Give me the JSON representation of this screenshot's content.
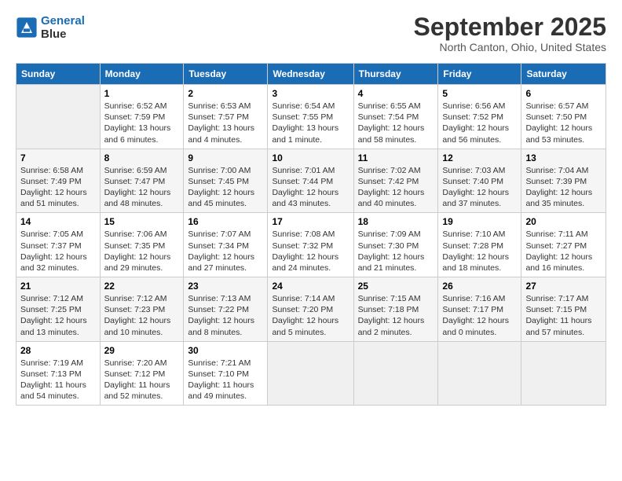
{
  "header": {
    "logo_line1": "General",
    "logo_line2": "Blue",
    "month": "September 2025",
    "location": "North Canton, Ohio, United States"
  },
  "days_of_week": [
    "Sunday",
    "Monday",
    "Tuesday",
    "Wednesday",
    "Thursday",
    "Friday",
    "Saturday"
  ],
  "weeks": [
    [
      {
        "day": "",
        "sunrise": "",
        "sunset": "",
        "daylight": ""
      },
      {
        "day": "1",
        "sunrise": "Sunrise: 6:52 AM",
        "sunset": "Sunset: 7:59 PM",
        "daylight": "Daylight: 13 hours and 6 minutes."
      },
      {
        "day": "2",
        "sunrise": "Sunrise: 6:53 AM",
        "sunset": "Sunset: 7:57 PM",
        "daylight": "Daylight: 13 hours and 4 minutes."
      },
      {
        "day": "3",
        "sunrise": "Sunrise: 6:54 AM",
        "sunset": "Sunset: 7:55 PM",
        "daylight": "Daylight: 13 hours and 1 minute."
      },
      {
        "day": "4",
        "sunrise": "Sunrise: 6:55 AM",
        "sunset": "Sunset: 7:54 PM",
        "daylight": "Daylight: 12 hours and 58 minutes."
      },
      {
        "day": "5",
        "sunrise": "Sunrise: 6:56 AM",
        "sunset": "Sunset: 7:52 PM",
        "daylight": "Daylight: 12 hours and 56 minutes."
      },
      {
        "day": "6",
        "sunrise": "Sunrise: 6:57 AM",
        "sunset": "Sunset: 7:50 PM",
        "daylight": "Daylight: 12 hours and 53 minutes."
      }
    ],
    [
      {
        "day": "7",
        "sunrise": "Sunrise: 6:58 AM",
        "sunset": "Sunset: 7:49 PM",
        "daylight": "Daylight: 12 hours and 51 minutes."
      },
      {
        "day": "8",
        "sunrise": "Sunrise: 6:59 AM",
        "sunset": "Sunset: 7:47 PM",
        "daylight": "Daylight: 12 hours and 48 minutes."
      },
      {
        "day": "9",
        "sunrise": "Sunrise: 7:00 AM",
        "sunset": "Sunset: 7:45 PM",
        "daylight": "Daylight: 12 hours and 45 minutes."
      },
      {
        "day": "10",
        "sunrise": "Sunrise: 7:01 AM",
        "sunset": "Sunset: 7:44 PM",
        "daylight": "Daylight: 12 hours and 43 minutes."
      },
      {
        "day": "11",
        "sunrise": "Sunrise: 7:02 AM",
        "sunset": "Sunset: 7:42 PM",
        "daylight": "Daylight: 12 hours and 40 minutes."
      },
      {
        "day": "12",
        "sunrise": "Sunrise: 7:03 AM",
        "sunset": "Sunset: 7:40 PM",
        "daylight": "Daylight: 12 hours and 37 minutes."
      },
      {
        "day": "13",
        "sunrise": "Sunrise: 7:04 AM",
        "sunset": "Sunset: 7:39 PM",
        "daylight": "Daylight: 12 hours and 35 minutes."
      }
    ],
    [
      {
        "day": "14",
        "sunrise": "Sunrise: 7:05 AM",
        "sunset": "Sunset: 7:37 PM",
        "daylight": "Daylight: 12 hours and 32 minutes."
      },
      {
        "day": "15",
        "sunrise": "Sunrise: 7:06 AM",
        "sunset": "Sunset: 7:35 PM",
        "daylight": "Daylight: 12 hours and 29 minutes."
      },
      {
        "day": "16",
        "sunrise": "Sunrise: 7:07 AM",
        "sunset": "Sunset: 7:34 PM",
        "daylight": "Daylight: 12 hours and 27 minutes."
      },
      {
        "day": "17",
        "sunrise": "Sunrise: 7:08 AM",
        "sunset": "Sunset: 7:32 PM",
        "daylight": "Daylight: 12 hours and 24 minutes."
      },
      {
        "day": "18",
        "sunrise": "Sunrise: 7:09 AM",
        "sunset": "Sunset: 7:30 PM",
        "daylight": "Daylight: 12 hours and 21 minutes."
      },
      {
        "day": "19",
        "sunrise": "Sunrise: 7:10 AM",
        "sunset": "Sunset: 7:28 PM",
        "daylight": "Daylight: 12 hours and 18 minutes."
      },
      {
        "day": "20",
        "sunrise": "Sunrise: 7:11 AM",
        "sunset": "Sunset: 7:27 PM",
        "daylight": "Daylight: 12 hours and 16 minutes."
      }
    ],
    [
      {
        "day": "21",
        "sunrise": "Sunrise: 7:12 AM",
        "sunset": "Sunset: 7:25 PM",
        "daylight": "Daylight: 12 hours and 13 minutes."
      },
      {
        "day": "22",
        "sunrise": "Sunrise: 7:12 AM",
        "sunset": "Sunset: 7:23 PM",
        "daylight": "Daylight: 12 hours and 10 minutes."
      },
      {
        "day": "23",
        "sunrise": "Sunrise: 7:13 AM",
        "sunset": "Sunset: 7:22 PM",
        "daylight": "Daylight: 12 hours and 8 minutes."
      },
      {
        "day": "24",
        "sunrise": "Sunrise: 7:14 AM",
        "sunset": "Sunset: 7:20 PM",
        "daylight": "Daylight: 12 hours and 5 minutes."
      },
      {
        "day": "25",
        "sunrise": "Sunrise: 7:15 AM",
        "sunset": "Sunset: 7:18 PM",
        "daylight": "Daylight: 12 hours and 2 minutes."
      },
      {
        "day": "26",
        "sunrise": "Sunrise: 7:16 AM",
        "sunset": "Sunset: 7:17 PM",
        "daylight": "Daylight: 12 hours and 0 minutes."
      },
      {
        "day": "27",
        "sunrise": "Sunrise: 7:17 AM",
        "sunset": "Sunset: 7:15 PM",
        "daylight": "Daylight: 11 hours and 57 minutes."
      }
    ],
    [
      {
        "day": "28",
        "sunrise": "Sunrise: 7:19 AM",
        "sunset": "Sunset: 7:13 PM",
        "daylight": "Daylight: 11 hours and 54 minutes."
      },
      {
        "day": "29",
        "sunrise": "Sunrise: 7:20 AM",
        "sunset": "Sunset: 7:12 PM",
        "daylight": "Daylight: 11 hours and 52 minutes."
      },
      {
        "day": "30",
        "sunrise": "Sunrise: 7:21 AM",
        "sunset": "Sunset: 7:10 PM",
        "daylight": "Daylight: 11 hours and 49 minutes."
      },
      {
        "day": "",
        "sunrise": "",
        "sunset": "",
        "daylight": ""
      },
      {
        "day": "",
        "sunrise": "",
        "sunset": "",
        "daylight": ""
      },
      {
        "day": "",
        "sunrise": "",
        "sunset": "",
        "daylight": ""
      },
      {
        "day": "",
        "sunrise": "",
        "sunset": "",
        "daylight": ""
      }
    ]
  ]
}
